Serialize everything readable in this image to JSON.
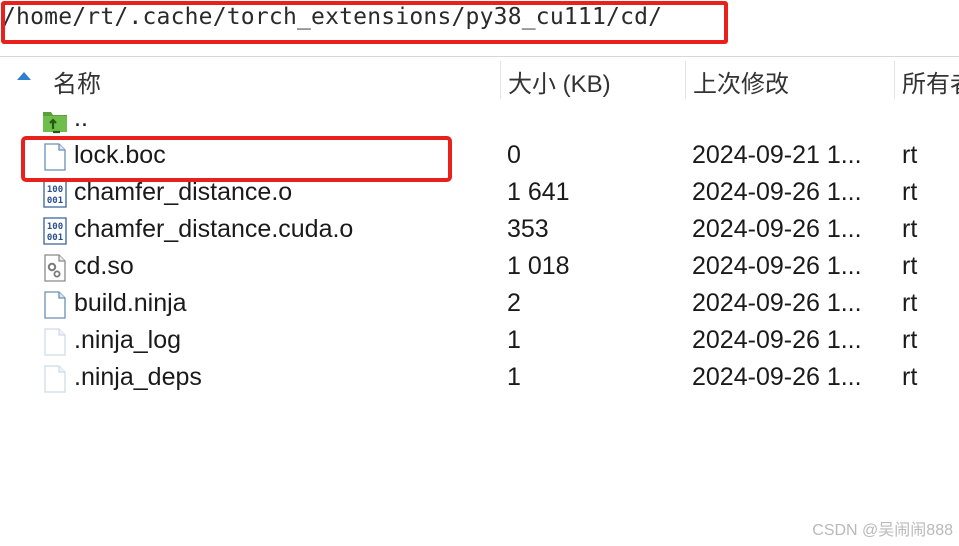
{
  "path_bar": {
    "path": "/home/rt/.cache/torch_extensions/py38_cu111/cd/"
  },
  "columns": {
    "name": "名称",
    "size": "大小 (KB)",
    "modified": "上次修改",
    "owner": "所有者"
  },
  "files": [
    {
      "name": "..",
      "size": "",
      "modified": "",
      "owner": "",
      "icon": "parent-folder-icon"
    },
    {
      "name": "lock.boc",
      "size": "0",
      "modified": "2024-09-21 1...",
      "owner": "rt",
      "icon": "file-icon"
    },
    {
      "name": "chamfer_distance.o",
      "size": "1 641",
      "modified": "2024-09-26 1...",
      "owner": "rt",
      "icon": "binary-file-icon"
    },
    {
      "name": "chamfer_distance.cuda.o",
      "size": "353",
      "modified": "2024-09-26 1...",
      "owner": "rt",
      "icon": "binary-file-icon"
    },
    {
      "name": "cd.so",
      "size": "1 018",
      "modified": "2024-09-26 1...",
      "owner": "rt",
      "icon": "library-file-icon"
    },
    {
      "name": "build.ninja",
      "size": "2",
      "modified": "2024-09-26 1...",
      "owner": "rt",
      "icon": "file-icon"
    },
    {
      "name": ".ninja_log",
      "size": "1",
      "modified": "2024-09-26 1...",
      "owner": "rt",
      "icon": "hidden-file-icon"
    },
    {
      "name": ".ninja_deps",
      "size": "1",
      "modified": "2024-09-26 1...",
      "owner": "rt",
      "icon": "hidden-file-icon"
    }
  ],
  "watermark": "CSDN @吴闹闹888",
  "colors": {
    "highlight": "#e8211d",
    "sort_arrow": "#2f7fd0"
  }
}
